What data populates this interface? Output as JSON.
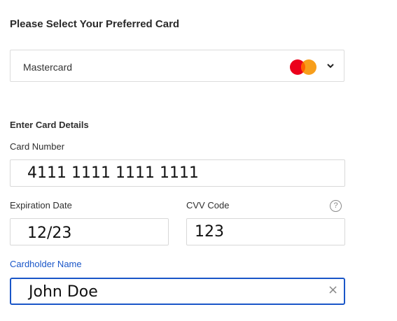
{
  "card_select": {
    "heading": "Please Select Your Preferred Card",
    "selected_value": "Mastercard",
    "brand_icon": "mastercard-logo-icon",
    "dropdown_icon": "chevron-down-icon",
    "colors": {
      "brand_red": "#eb001b",
      "brand_orange": "#f79e1b"
    }
  },
  "card_details": {
    "section_title": "Enter Card Details",
    "card_number_label": "Card Number",
    "card_number_value": "4111 1111 1111 1111",
    "expiration_label": "Expiration Date",
    "expiration_value": "12/23",
    "cvv_label": "CVV Code",
    "cvv_value": "123",
    "cvv_help_icon": "question-mark",
    "cvv_help_glyph": "?",
    "cardholder_label": "Cardholder Name",
    "cardholder_value": "John Doe",
    "clear_icon": "close-icon",
    "clear_glyph": "×"
  },
  "accent_color": "#1a56c8"
}
